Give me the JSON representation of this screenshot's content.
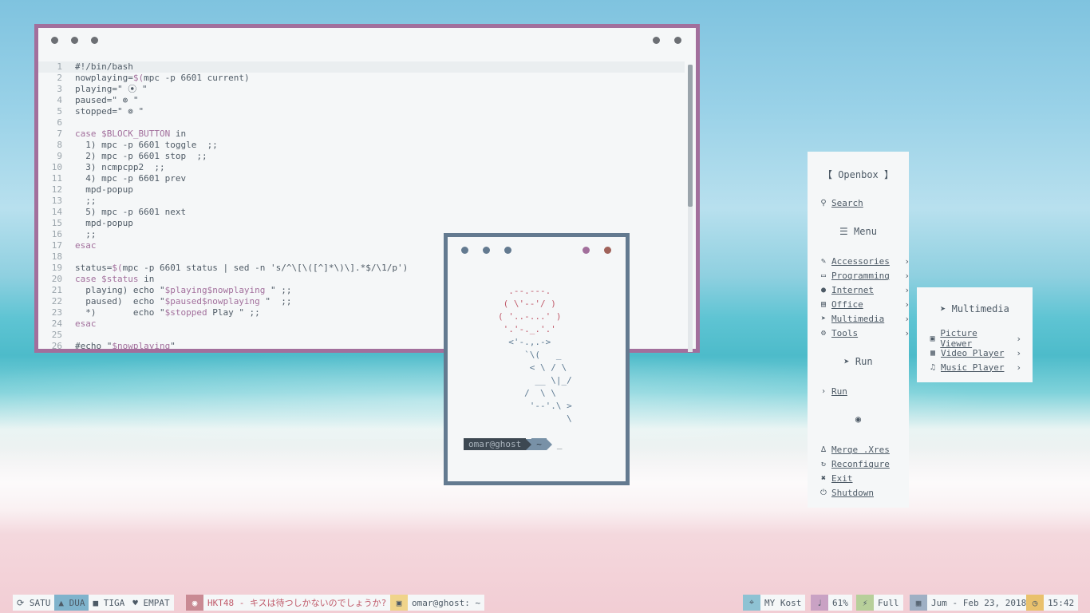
{
  "editor": {
    "lines": [
      {
        "n": "1",
        "t": "#!/bin/bash"
      },
      {
        "n": "2",
        "t": "nowplaying=$(mpc -p 6601 current)"
      },
      {
        "n": "3",
        "t": "playing=\" ⦿ \""
      },
      {
        "n": "4",
        "t": "paused=\" ⊚ \""
      },
      {
        "n": "5",
        "t": "stopped=\" ⊚ \""
      },
      {
        "n": "6",
        "t": ""
      },
      {
        "n": "7",
        "t": "case $BLOCK_BUTTON in"
      },
      {
        "n": "8",
        "t": "  1) mpc -p 6601 toggle  ;;"
      },
      {
        "n": "9",
        "t": "  2) mpc -p 6601 stop  ;;"
      },
      {
        "n": "10",
        "t": "  3) ncmpcpp2  ;;"
      },
      {
        "n": "11",
        "t": "  4) mpc -p 6601 prev"
      },
      {
        "n": "12",
        "t": "  mpd-popup"
      },
      {
        "n": "13",
        "t": "  ;;"
      },
      {
        "n": "14",
        "t": "  5) mpc -p 6601 next"
      },
      {
        "n": "15",
        "t": "  mpd-popup"
      },
      {
        "n": "16",
        "t": "  ;;"
      },
      {
        "n": "17",
        "t": "esac"
      },
      {
        "n": "18",
        "t": ""
      },
      {
        "n": "19",
        "t": "status=$(mpc -p 6601 status | sed -n 's/^\\[\\([^]*\\)\\].*$/\\1/p')"
      },
      {
        "n": "20",
        "t": "case $status in"
      },
      {
        "n": "21",
        "t": "  playing) echo \"$playing$nowplaying \" ;;"
      },
      {
        "n": "22",
        "t": "  paused)  echo \"$paused$nowplaying \"  ;;"
      },
      {
        "n": "23",
        "t": "  *)       echo \"$stopped Play \" ;;"
      },
      {
        "n": "24",
        "t": "esac"
      },
      {
        "n": "25",
        "t": ""
      },
      {
        "n": "26",
        "t": "#echo \"$nowplaying\""
      }
    ]
  },
  "terminal": {
    "ascii_pink": "          .--.---.\n         ( \\'--'/ )\n        ( '..-...' )\n         '.'-._.'.'",
    "ascii_blue": "          <'-.,.->\n             `\\(   _\n              < \\ / \\\n               __ \\|_/\n             /  \\ \\\n              '--'.\\ >\n                     \\",
    "user": "omar@ghost",
    "dir": "~",
    "cursor": "_"
  },
  "menu": {
    "title": "【 Openbox 】",
    "search": "Search",
    "menu_header": "Menu",
    "items": [
      {
        "icon": "brush-icon",
        "glyph": "✎",
        "label": "Accessories"
      },
      {
        "icon": "terminal-icon",
        "glyph": "▭",
        "label": "Programming"
      },
      {
        "icon": "globe-icon",
        "glyph": "●",
        "label": "Internet"
      },
      {
        "icon": "document-icon",
        "glyph": "▤",
        "label": "Office"
      },
      {
        "icon": "rocket-icon",
        "glyph": "➤",
        "label": "Multimedia"
      },
      {
        "icon": "gears-icon",
        "glyph": "⚙",
        "label": "Tools"
      }
    ],
    "run_header": "Run",
    "run_item": "Run",
    "actions": [
      {
        "icon": "flask-icon",
        "glyph": "∆",
        "label": "Merge .Xres"
      },
      {
        "icon": "refresh-icon",
        "glyph": "↻",
        "label": "Reconfigure"
      },
      {
        "icon": "exit-icon",
        "glyph": "✖",
        "label": "Exit"
      },
      {
        "icon": "power-icon",
        "glyph": "⏻",
        "label": "Shutdown"
      }
    ]
  },
  "submenu": {
    "title": "Multimedia",
    "items": [
      {
        "icon": "image-icon",
        "glyph": "▣",
        "label": "Picture Viewer"
      },
      {
        "icon": "film-icon",
        "glyph": "▦",
        "label": "Video Player"
      },
      {
        "icon": "music-icon",
        "glyph": "♫",
        "label": "Music Player"
      }
    ]
  },
  "bar": {
    "workspaces": [
      "SATU",
      "DUA",
      "TIGA",
      "EMPAT"
    ],
    "music": "HKT48 - キスは待つしかないのでしょうか?",
    "window": "omar@ghost: ~",
    "wifi": "MY Kost",
    "volume": "61%",
    "battery": "Full",
    "date": "Jum - Feb 23, 2018",
    "time": "15:42"
  },
  "colors": {
    "accent_purple": "#a26f9c",
    "accent_slate": "#637a90",
    "active_workspace": "#7fb3cc",
    "music_icon_bg": "#c98a93",
    "window_icon_bg": "#f0d48a",
    "wifi_bg": "#8ec2d3",
    "volume_bg": "#c9a2c4",
    "battery_bg": "#b7cf9a",
    "date_bg": "#9fb0c4",
    "time_bg": "#e9c16c"
  }
}
